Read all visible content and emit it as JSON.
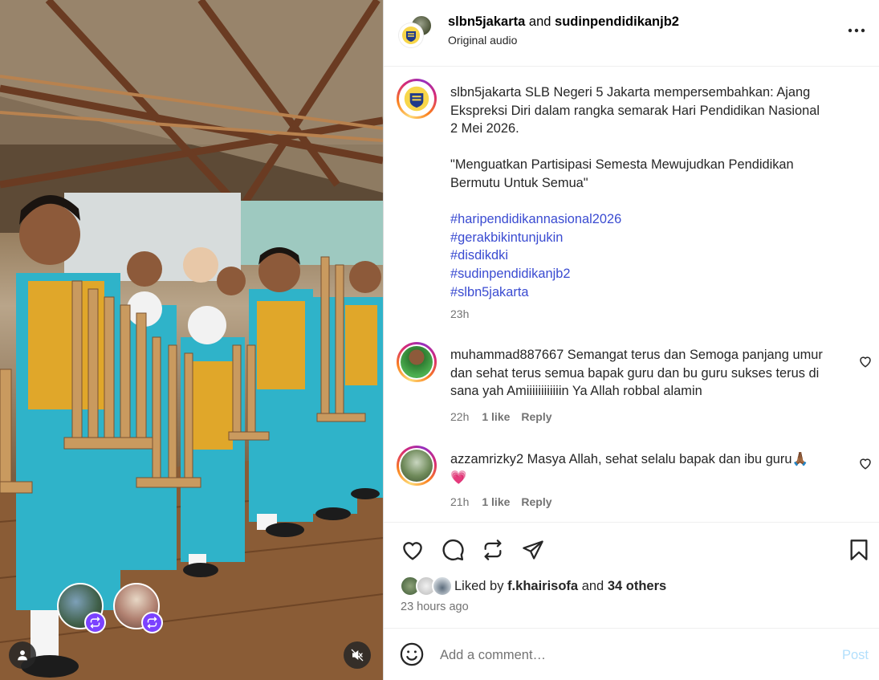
{
  "header": {
    "account1": "slbn5jakarta",
    "joiner": "and",
    "account2": "sudinpendidikanjb2",
    "audio": "Original audio",
    "more_icon": "more-horizontal-icon"
  },
  "caption": {
    "username": "slbn5jakarta",
    "text1": "SLB Negeri 5 Jakarta mempersembahkan: Ajang Ekspreksi Diri dalam rangka semarak Hari Pendidikan Nasional 2 Mei 2026.",
    "text2": "\"Menguatkan Partisipasi Semesta Mewujudkan Pendidikan Bermutu Untuk Semua\"",
    "hashtags": [
      "#haripendidikannasional2026",
      "#gerakbikintunjukin",
      "#disdikdki",
      "#sudinpendidikanjb2",
      "#slbn5jakarta"
    ],
    "time": "23h"
  },
  "comments": [
    {
      "username": "muhammad887667",
      "text": "Semangat terus dan Semoga panjang umur dan sehat terus semua bapak guru dan bu guru sukses terus di sana yah Amiiiiiiiiiiiin Ya Allah robbal alamin",
      "time": "22h",
      "likes": "1 like",
      "reply": "Reply"
    },
    {
      "username": "azzamrizky2",
      "text": "Masya Allah, sehat selalu bapak dan ibu guru🙏🏾",
      "emoji_line": "💗",
      "time": "21h",
      "likes": "1 like",
      "reply": "Reply"
    }
  ],
  "actions": {
    "liked_prefix": "Liked by",
    "liked_user": "f.khairisofa",
    "liked_and": "and",
    "liked_others": "34 others",
    "time_ago": "23 hours ago"
  },
  "comment_box": {
    "placeholder": "Add a comment…",
    "post_label": "Post"
  },
  "colors": {
    "hashtag": "#3a4bd1",
    "repost_badge": "#7b42ff",
    "post_disabled": "#b2dffc"
  }
}
